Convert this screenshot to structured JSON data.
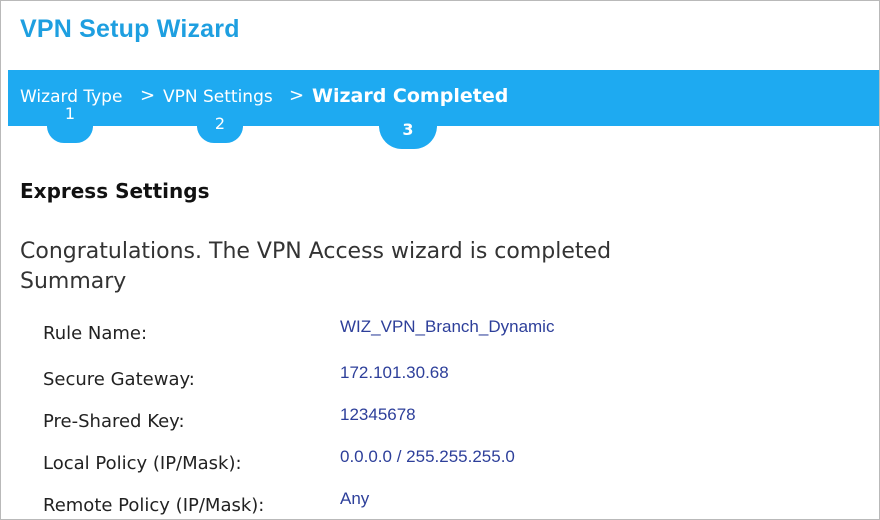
{
  "window": {
    "title": "VPN Setup Wizard"
  },
  "steps": [
    {
      "label": "Wizard Type",
      "number": "1",
      "state": "done"
    },
    {
      "label": "VPN Settings",
      "number": "2",
      "state": "done"
    },
    {
      "label": "Wizard Completed",
      "number": "3",
      "state": "current"
    }
  ],
  "step_separator": ">",
  "content": {
    "heading": "Express Settings",
    "message": "Congratulations. The VPN Access wizard is completed",
    "summary_label": "Summary",
    "summary": [
      {
        "label": "Rule Name:",
        "value": "WIZ_VPN_Branch_Dynamic"
      },
      {
        "label": "Secure Gateway:",
        "value": "172.101.30.68"
      },
      {
        "label": "Pre-Shared Key:",
        "value": "12345678"
      },
      {
        "label": "Local Policy (IP/Mask):",
        "value": "0.0.0.0 / 255.255.255.0"
      },
      {
        "label": "Remote Policy (IP/Mask):",
        "value": "Any"
      }
    ]
  },
  "colors": {
    "accent": "#1eaaf1",
    "title": "#1e9fe0",
    "value_text": "#2d3f9a"
  }
}
